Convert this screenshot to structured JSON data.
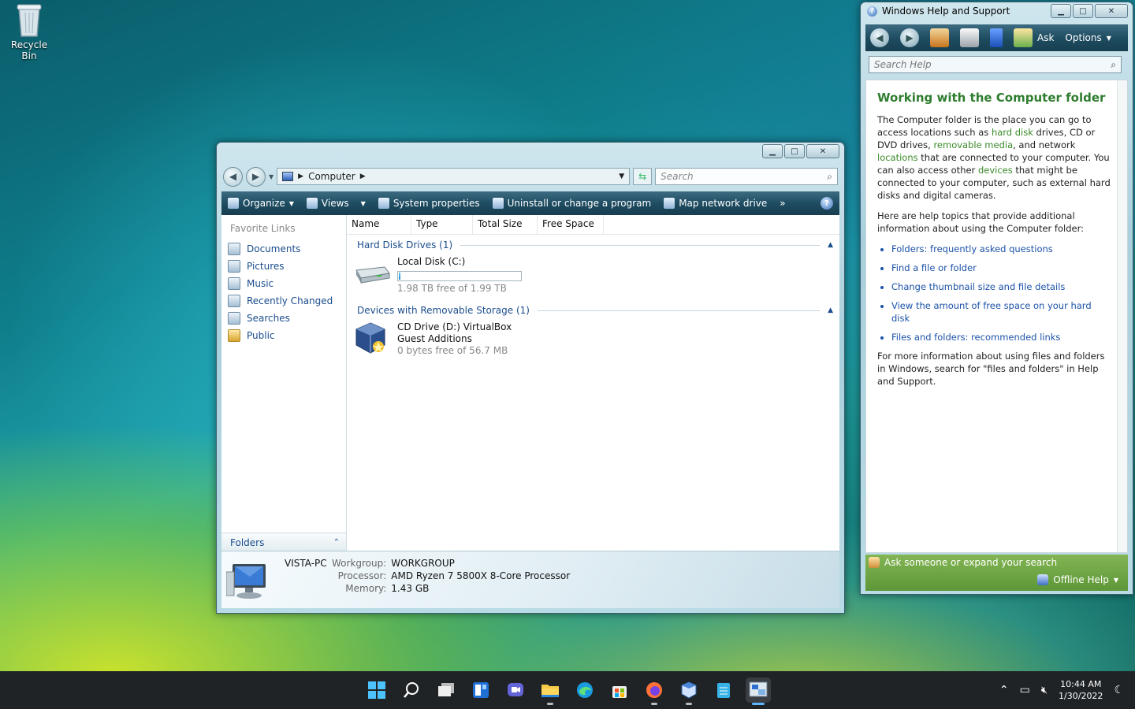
{
  "desktop": {
    "recycle_bin": "Recycle Bin"
  },
  "explorer": {
    "address": {
      "segment": "Computer"
    },
    "search_placeholder": "Search",
    "toolbar": {
      "organize": "Organize",
      "views": "Views",
      "system_properties": "System properties",
      "uninstall": "Uninstall or change a program",
      "map_drive": "Map network drive",
      "more": "»"
    },
    "favorites_header": "Favorite Links",
    "favorites": [
      "Documents",
      "Pictures",
      "Music",
      "Recently Changed",
      "Searches",
      "Public"
    ],
    "folders_label": "Folders",
    "columns": [
      "Name",
      "Type",
      "Total Size",
      "Free Space"
    ],
    "groups": [
      {
        "label": "Hard Disk Drives (1)",
        "items": [
          {
            "name": "Local Disk (C:)",
            "sub": "1.98 TB free of 1.99 TB",
            "used_fraction": 0.005
          }
        ]
      },
      {
        "label": "Devices with Removable Storage (1)",
        "items": [
          {
            "name": "CD Drive (D:) VirtualBox Guest Additions",
            "sub": "0 bytes free of 56.7 MB"
          }
        ]
      }
    ],
    "details": {
      "pc_name": "VISTA-PC",
      "workgroup_label": "Workgroup:",
      "workgroup": "WORKGROUP",
      "processor_label": "Processor:",
      "processor": "AMD Ryzen 7 5800X 8-Core Processor",
      "memory_label": "Memory:",
      "memory": "1.43 GB"
    }
  },
  "help": {
    "title": "Windows Help and Support",
    "ask": "Ask",
    "options": "Options",
    "search_placeholder": "Search Help",
    "heading": "Working with the Computer folder",
    "intro": {
      "t1": "The Computer folder is the place you can go to access locations such as ",
      "l1": "hard disk",
      "t2": " drives, CD or DVD drives, ",
      "l2": "removable media",
      "t3": ", and network ",
      "l3": "locations",
      "t4": " that are connected to your computer. You can also access other ",
      "l4": "devices",
      "t5": " that might be connected to your computer, such as external hard disks and digital cameras."
    },
    "topics_intro": "Here are help topics that provide additional information about using the Computer folder:",
    "topics": [
      "Folders: frequently asked questions",
      "Find a file or folder",
      "Change thumbnail size and file details",
      "View the amount of free space on your hard disk",
      "Files and folders: recommended links"
    ],
    "more_info": "For more information about using files and folders in Windows, search for \"files and folders\" in Help and Support.",
    "footer_ask": "Ask someone or expand your search",
    "footer_offline": "Offline Help"
  },
  "taskbar": {
    "time": "10:44 AM",
    "date": "1/30/2022",
    "icons": [
      "start-icon",
      "search-icon",
      "task-view-icon",
      "widgets-icon",
      "chat-icon",
      "file-explorer-icon",
      "edge-icon",
      "store-icon",
      "firefox-icon",
      "virtualbox-icon",
      "notepad-icon",
      "vista-vm-icon"
    ]
  }
}
